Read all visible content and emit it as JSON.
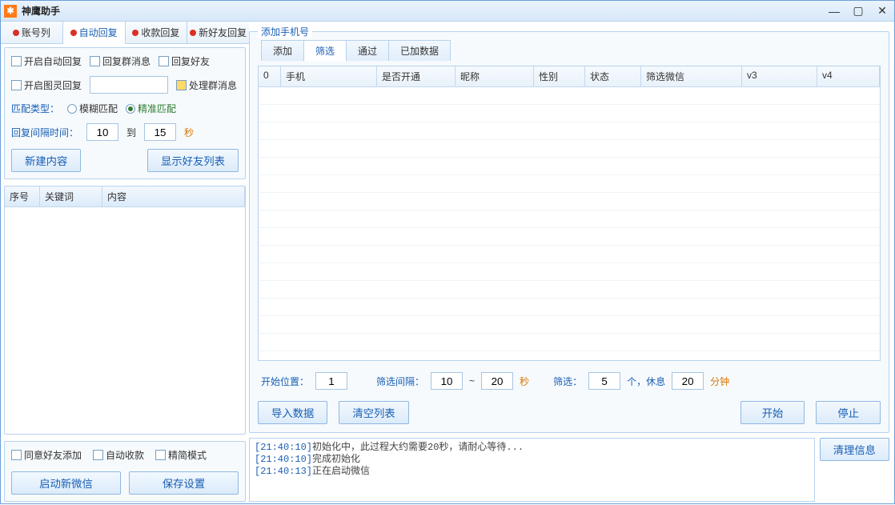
{
  "title": "神鹰助手",
  "sideTabs": [
    "账号列",
    "自动回复",
    "收款回复",
    "新好友回复"
  ],
  "activeSideTab": 1,
  "settings": {
    "chkAutoReply": "开启自动回复",
    "chkGroupMsg": "回复群消息",
    "chkFriend": "回复好友",
    "chkTuling": "开启图灵回复",
    "chkHandleGroup": "处理群消息",
    "matchTypeLabel": "匹配类型：",
    "radioFuzzy": "模糊匹配",
    "radioExact": "精准匹配",
    "intervalLabel": "回复间隔时间：",
    "intervalFrom": "10",
    "intervalTo": "15",
    "intervalToWord": "到",
    "secUnit": "秒",
    "btnNewContent": "新建内容",
    "btnShowFriends": "显示好友列表"
  },
  "kwCols": {
    "no": "序号",
    "keyword": "关键词",
    "content": "内容"
  },
  "bottom": {
    "chkAgreeAdd": "同意好友添加",
    "chkAutoPay": "自动收款",
    "chkSimple": "精简模式",
    "btnStartWx": "启动新微信",
    "btnSaveCfg": "保存设置"
  },
  "main": {
    "groupTitle": "添加手机号",
    "subTabs": [
      "添加",
      "筛选",
      "通过",
      "已加数据"
    ],
    "activeSubTab": 1,
    "gridCols": [
      "0",
      "手机",
      "是否开通",
      "昵称",
      "性别",
      "状态",
      "筛选微信",
      "v3",
      "v4"
    ],
    "filter": {
      "startPosLabel": "开始位置：",
      "startPosVal": "1",
      "intervalLabel": "筛选间隔：",
      "intervalFrom": "10",
      "dash": "~",
      "intervalTo": "20",
      "sec": "秒",
      "filterLabel": "筛选：",
      "filterVal": "5",
      "countUnit": "个，休息",
      "restVal": "20",
      "minUnit": "分钟"
    },
    "btnImport": "导入数据",
    "btnClear": "清空列表",
    "btnStart": "开始",
    "btnStop": "停止"
  },
  "log": {
    "l1ts": "[21:40:10]",
    "l1": "初始化中，此过程大约需要20秒，请耐心等待...",
    "l2ts": "[21:40:10]",
    "l2": "完成初始化",
    "l3ts": "[21:40:13]",
    "l3": "正在启动微信",
    "btnClearLog": "清理信息"
  }
}
